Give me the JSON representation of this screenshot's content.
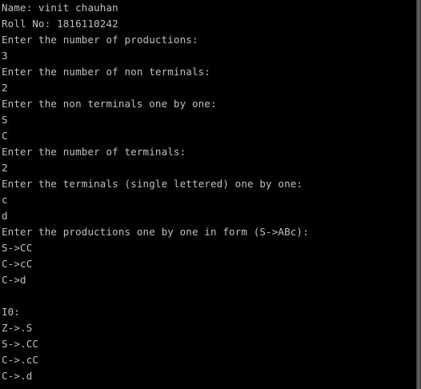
{
  "console": {
    "lines": [
      "Name: vinit chauhan",
      "Roll No: 1816110242",
      "Enter the number of productions:",
      "3",
      "Enter the number of non terminals:",
      "2",
      "Enter the non terminals one by one:",
      "S",
      "C",
      "Enter the number of terminals:",
      "2",
      "Enter the terminals (single lettered) one by one:",
      "c",
      "d",
      "Enter the productions one by one in form (S->ABc):",
      "S->CC",
      "C->cC",
      "C->d",
      "",
      "I0:",
      "Z->.S",
      "S->.CC",
      "C->.cC",
      "C->.d"
    ]
  },
  "colors": {
    "background": "#000000",
    "text": "#c0c0c0"
  }
}
